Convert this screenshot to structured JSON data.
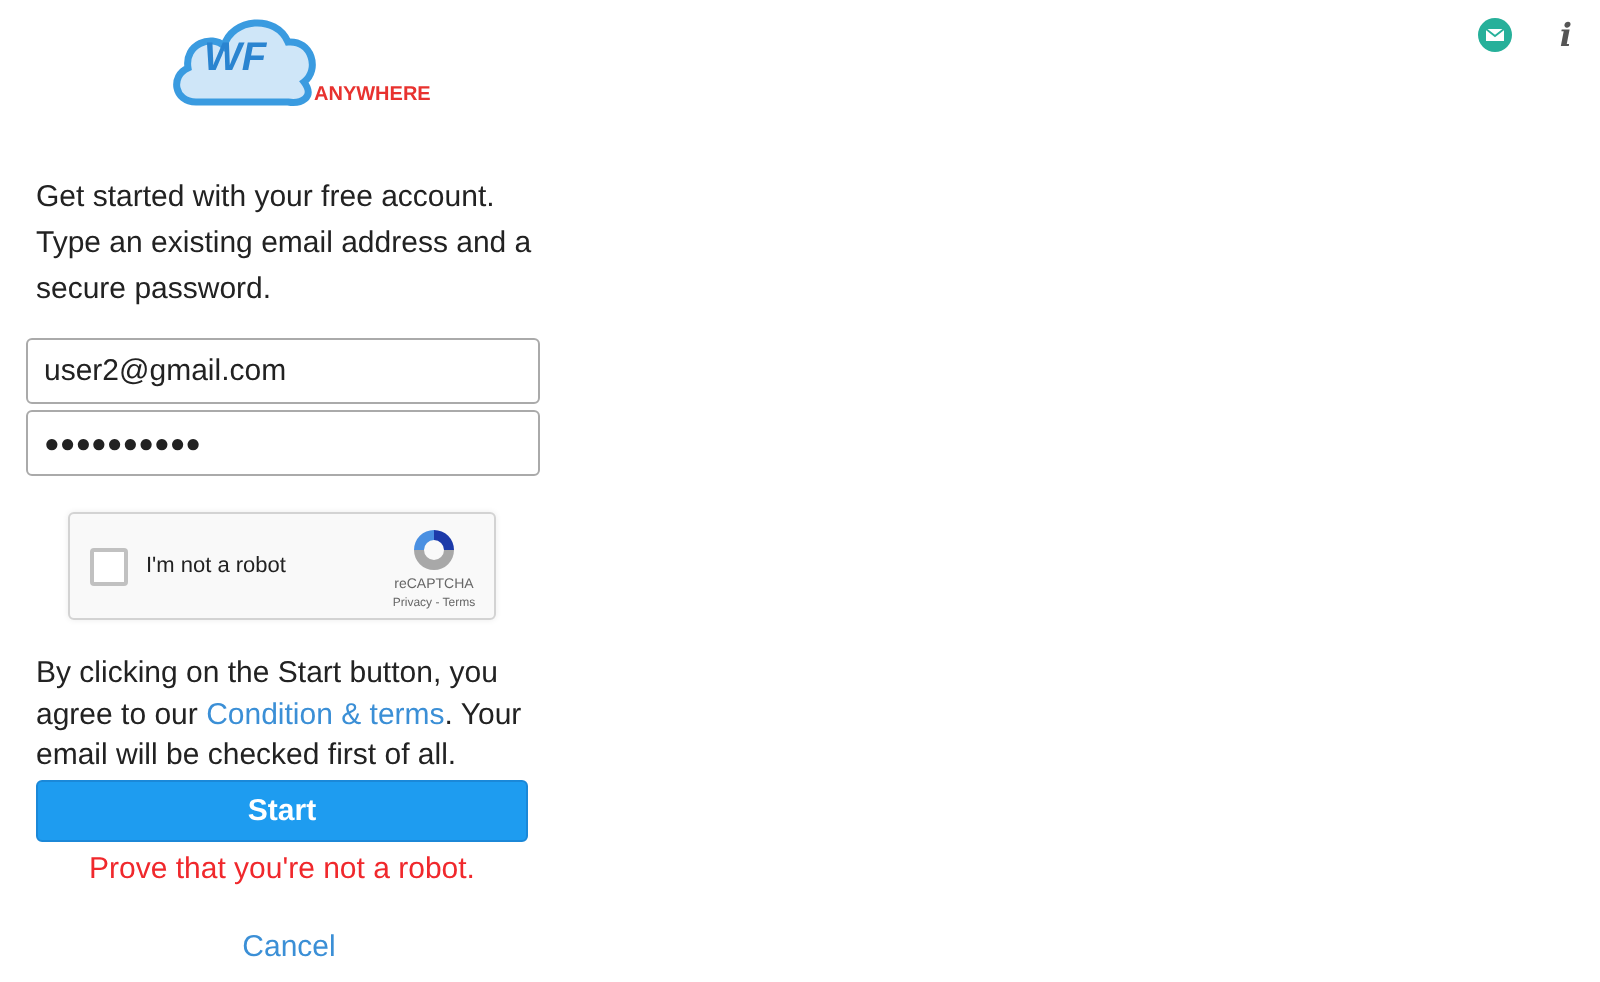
{
  "logo": {
    "mark": "WF",
    "tagline": "ANYWHERE"
  },
  "header_icons": [
    {
      "kind": "mail"
    },
    {
      "kind": "info",
      "glyph": "i"
    }
  ],
  "intro": "Get started with your free account. Type an existing email address and a secure password.",
  "email": {
    "value": "user2@gmail.com"
  },
  "password": {
    "value": "●●●●●●●●●●"
  },
  "captcha": {
    "label": "I'm not a robot",
    "checked": false,
    "brand": "reCAPTCHA",
    "links": "Privacy - Terms"
  },
  "agreement": {
    "before": "By clicking on the Start button, you agree to our ",
    "link": "Condition & terms",
    "after": ". Your email will be checked first of all."
  },
  "start_button": "Start",
  "error": "Prove that you're not a robot.",
  "cancel": "Cancel"
}
